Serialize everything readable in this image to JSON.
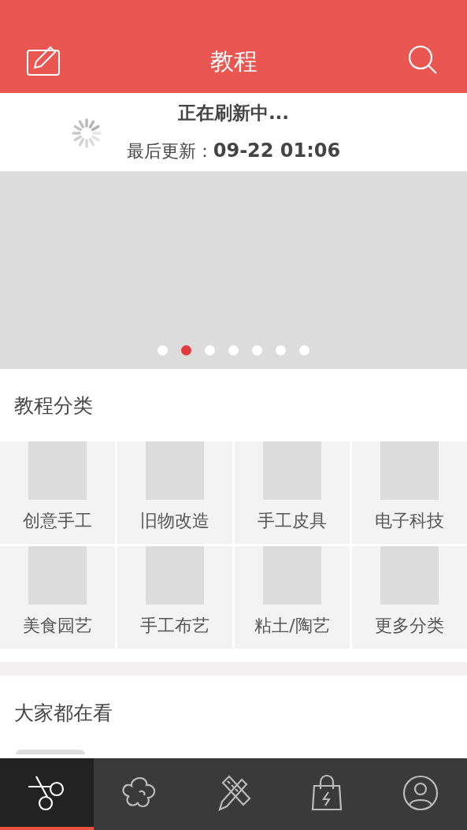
{
  "header": {
    "title": "教程"
  },
  "refresh": {
    "status": "正在刷新中...",
    "last_update_label": "最后更新：",
    "last_update_time": "09-22 01:06"
  },
  "banner": {
    "dots": [
      {
        "selected": false
      },
      {
        "selected": true
      },
      {
        "selected": false
      },
      {
        "selected": false
      },
      {
        "selected": false
      },
      {
        "selected": false
      },
      {
        "selected": false
      }
    ]
  },
  "categories": {
    "title": "教程分类",
    "items": [
      {
        "label": "创意手工"
      },
      {
        "label": "旧物改造"
      },
      {
        "label": "手工皮具"
      },
      {
        "label": "电子科技"
      },
      {
        "label": "美食园艺"
      },
      {
        "label": "手工布艺"
      },
      {
        "label": "粘土/陶艺"
      },
      {
        "label": "更多分类"
      }
    ]
  },
  "popular": {
    "title": "大家都在看"
  },
  "tab_bar": [
    {
      "kind": "scissors",
      "selected": true
    },
    {
      "kind": "flower",
      "selected": false
    },
    {
      "kind": "tools",
      "selected": false
    },
    {
      "kind": "bag",
      "selected": false
    },
    {
      "kind": "profile",
      "selected": false
    }
  ]
}
